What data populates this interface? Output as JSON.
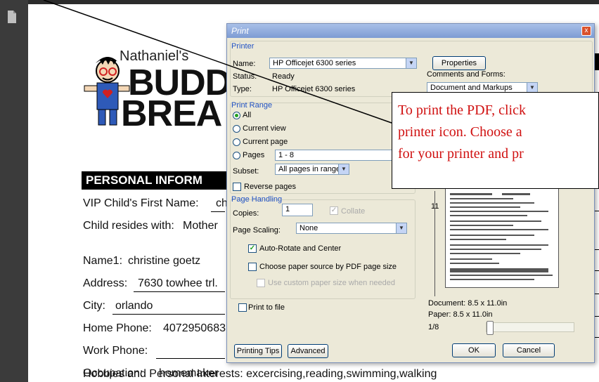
{
  "document": {
    "logo_text_top": "Nathaniel's",
    "logo_text_big1": "BUDD",
    "logo_text_big2": "BREA",
    "section_title": "PERSONAL INFORM",
    "fields": [
      {
        "label": "VIP Child's First Name:",
        "value": "ch"
      },
      {
        "label": "Child resides with:",
        "value": "Mother"
      },
      {
        "label": "Name1:",
        "value": "christine goetz"
      },
      {
        "label": "Address:",
        "value": "7630 towhee trl."
      },
      {
        "label": "City:",
        "value": "orlando"
      },
      {
        "label": "Home Phone:",
        "value": "4072950683"
      },
      {
        "label": "Work Phone:",
        "value": ""
      },
      {
        "label": "Occupation:",
        "value": "homemaker"
      },
      {
        "label": "Hobbies and Personal Interests:",
        "value": "excercising,reading,swimming,walking"
      }
    ]
  },
  "dialog": {
    "title": "Print",
    "close": "x",
    "printer_section": "Printer",
    "name_label": "Name:",
    "printer_name": "HP Officejet 6300 series",
    "properties_button": "Properties",
    "status_label": "Status:",
    "status_value": "Ready",
    "type_label": "Type:",
    "type_value": "HP Officejet 6300 series",
    "comments_label": "Comments and Forms:",
    "comments_value": "Document and Markups",
    "print_range_section": "Print Range",
    "range_all": "All",
    "range_current_view": "Current view",
    "range_current_page": "Current page",
    "range_pages": "Pages",
    "pages_value": "1 - 8",
    "subset_label": "Subset:",
    "subset_value": "All pages in range",
    "reverse_pages": "Reverse pages",
    "page_handling_section": "Page Handling",
    "copies_label": "Copies:",
    "copies_value": "1",
    "collate": "Collate",
    "page_scaling_label": "Page Scaling:",
    "page_scaling_value": "None",
    "auto_rotate": "Auto-Rotate and Center",
    "choose_paper_source": "Choose paper source by PDF page size",
    "custom_paper": "Use custom paper size when needed",
    "print_to_file": "Print to file",
    "printing_tips_button": "Printing Tips",
    "advanced_button": "Advanced",
    "ok_button": "OK",
    "cancel_button": "Cancel",
    "preview_dimension_11": "11",
    "document_size": "Document: 8.5 x 11.0in",
    "paper_size": "Paper: 8.5 x 11.0in",
    "page_indicator": "1/8",
    "page_slider_fraction": 0.0
  },
  "callout": {
    "line1": "To print the PDF, click",
    "line2": "printer icon.  Choose a",
    "line3": "for your printer and pr"
  },
  "colors": {
    "callout_text": "#d01010",
    "section_label": "#2152c4",
    "dialog_bg": "#ece9d8"
  }
}
